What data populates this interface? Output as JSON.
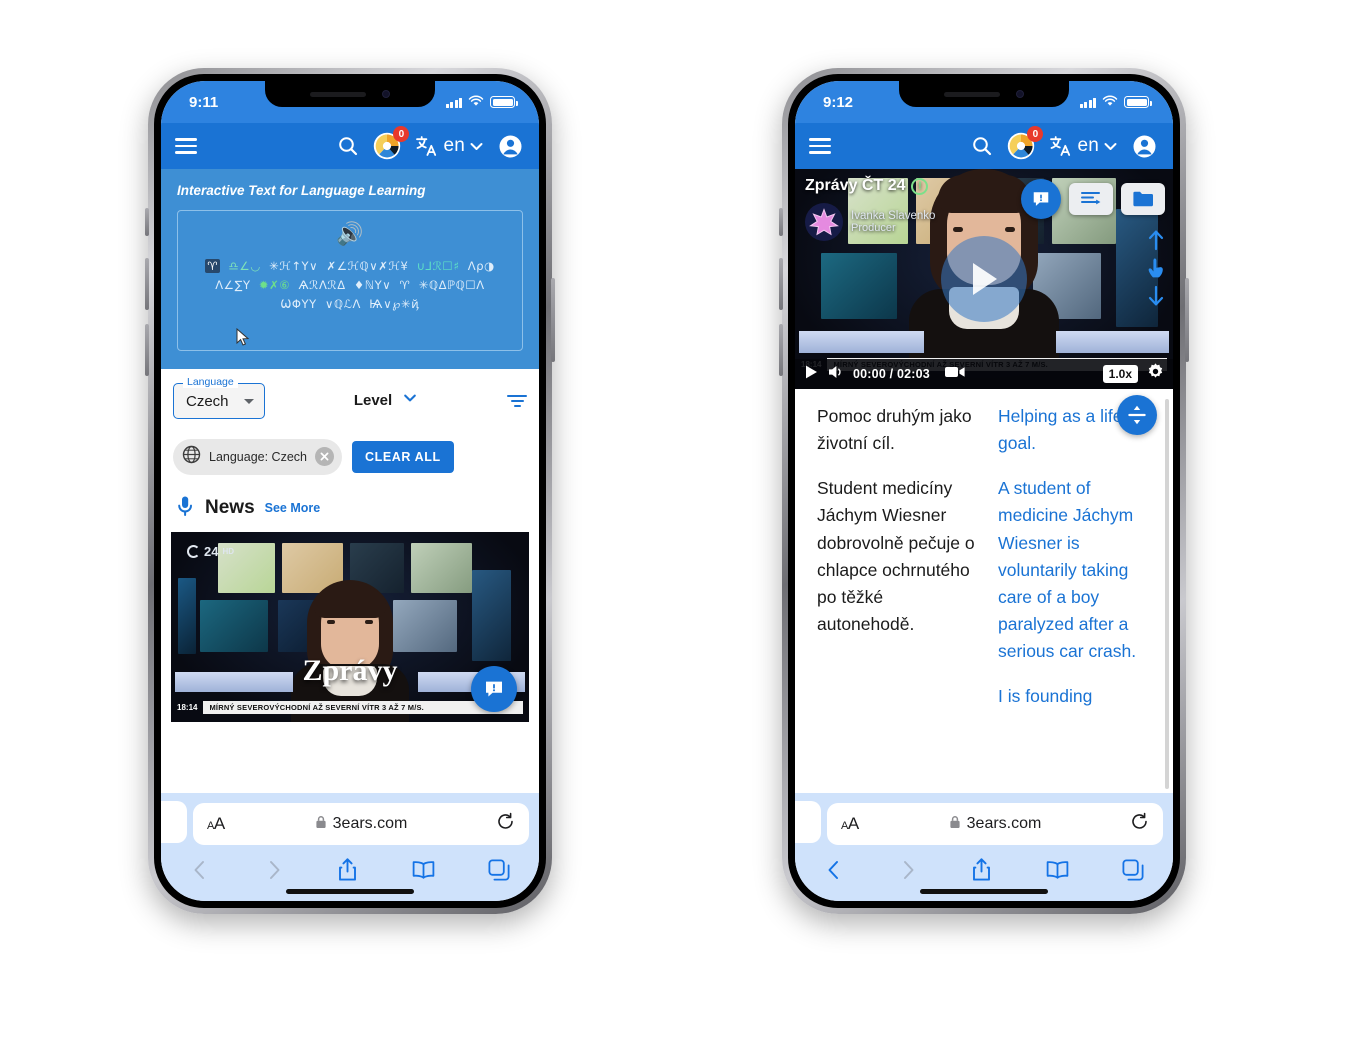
{
  "phone_left": {
    "status": {
      "time": "9:11",
      "signal_icon": "cellular-bars-icon",
      "wifi_icon": "wifi-icon",
      "battery_icon": "battery-icon"
    },
    "appbar": {
      "menu_icon": "hamburger-menu-icon",
      "search_icon": "search-icon",
      "progress_icon": "progress-donut-icon",
      "progress_badge": "0",
      "translate_icon": "translate-icon",
      "lang_code": "en",
      "chevron_icon": "chevron-down-icon",
      "account_icon": "account-circle-icon"
    },
    "hero": {
      "title": "Interactive Text for Language Learning",
      "speaker_icon": "speaker-volume-icon",
      "glyph_lines": [
        "♈ ♎∠◡ ✳ℋ↑Υ∨ ✗∠ℋℚ∨✗ℋ¥ ∪⅃ℛ☐♯ Λρ◑",
        "Λ∠∑Υ ✹✗♆ ѦℛΛℛΔ ♦ℕΥ∨ ♈ ✳ℚΔℙℚ☐Λ",
        "ѠΦΥΥ ∨ℚ℔Λ Ѩ∨℘✳ђ"
      ],
      "cursor_icon": "mouse-cursor-icon"
    },
    "filters": {
      "language_legend": "Language",
      "language_value": "Czech",
      "language_caret_icon": "caret-down-icon",
      "level_label": "Level",
      "level_caret_icon": "chevron-down-icon",
      "filter_icon": "filter-list-icon",
      "chip": {
        "icon": "globe-icon",
        "label": "Language: Czech",
        "remove_icon": "close-circle-icon"
      },
      "clear_all": "CLEAR ALL"
    },
    "news": {
      "mic_icon": "microphone-icon",
      "title": "News",
      "see_more": "See More",
      "thumb": {
        "channel_logo": "24",
        "channel_hd": "HD",
        "overlay_title": "Zprávy",
        "ticker_time": "18:14",
        "ticker_text": "MÍRNÝ SEVEROVÝCHODNÍ AŽ SEVERNÍ VÍTR 3 AŽ 7 M/S.",
        "fab_icon": "alert-chat-icon"
      }
    },
    "safari": {
      "aa_label": "AA",
      "lock_icon": "lock-icon",
      "url": "3ears.com",
      "reload_icon": "reload-icon",
      "back_icon": "chevron-left-icon",
      "forward_icon": "chevron-right-icon",
      "share_icon": "share-icon",
      "bookmarks_icon": "book-icon",
      "tabs_icon": "tabs-icon"
    }
  },
  "phone_right": {
    "status": {
      "time": "9:12",
      "signal_icon": "cellular-bars-icon",
      "wifi_icon": "wifi-icon",
      "battery_icon": "battery-icon"
    },
    "appbar": {
      "menu_icon": "hamburger-menu-icon",
      "search_icon": "search-icon",
      "progress_icon": "progress-donut-icon",
      "progress_badge": "0",
      "translate_icon": "translate-icon",
      "lang_code": "en",
      "chevron_icon": "chevron-down-icon",
      "account_icon": "account-circle-icon"
    },
    "player": {
      "channel_title": "Zprávy ČT 24",
      "info_icon": "info-circle-icon",
      "info_glyph": "!",
      "avatar_icon": "star-avatar-icon",
      "producer_name": "Ivanka Slavenko",
      "producer_role": "Producer",
      "alert_icon": "alert-chat-icon",
      "transcript_icon": "transcript-lines-icon",
      "folder_icon": "folder-icon",
      "play_icon": "play-overlay-icon",
      "resize_up_icon": "arrow-up-icon",
      "resize_hand_icon": "tap-hand-icon",
      "resize_down_icon": "arrow-down-icon",
      "ticker_time": "18:14",
      "ticker_text": "MÍRNÝ SEVEROVÝCHODNÍ AŽ SEVERNÍ VÍTR 3 AŽ 7 M/S.",
      "controls": {
        "play_icon": "play-icon",
        "volume_icon": "volume-icon",
        "time": "00:00 / 02:03",
        "pip_icon": "picture-in-picture-icon",
        "speed": "1.0x",
        "settings_icon": "gear-icon"
      }
    },
    "reader": {
      "split_icon": "split-view-icon",
      "source_paragraphs": [
        "Pomoc druhým jako životní cíl.",
        "Student medicíny Jáchym Wiesner dobrovolně pečuje o chlapce ochrnutého po těžké autonehodě."
      ],
      "target_paragraphs": [
        "Helping as a lifetime goal.",
        "A student of medicine Jáchym Wiesner is voluntarily taking care of a boy paralyzed after a serious car crash.",
        "I is founding"
      ]
    },
    "safari": {
      "aa_label": "AA",
      "lock_icon": "lock-icon",
      "url": "3ears.com",
      "reload_icon": "reload-icon",
      "back_icon": "chevron-left-icon",
      "forward_icon": "chevron-right-icon",
      "share_icon": "share-icon",
      "bookmarks_icon": "book-icon",
      "tabs_icon": "tabs-icon"
    }
  },
  "colors": {
    "brand_blue": "#1a73d4",
    "status_blue": "#2e83e0",
    "hero_blue": "#3e8fd4",
    "badge_red": "#e8392c",
    "safari_bg": "#cfe2fb",
    "link_blue": "#1a73d4"
  }
}
